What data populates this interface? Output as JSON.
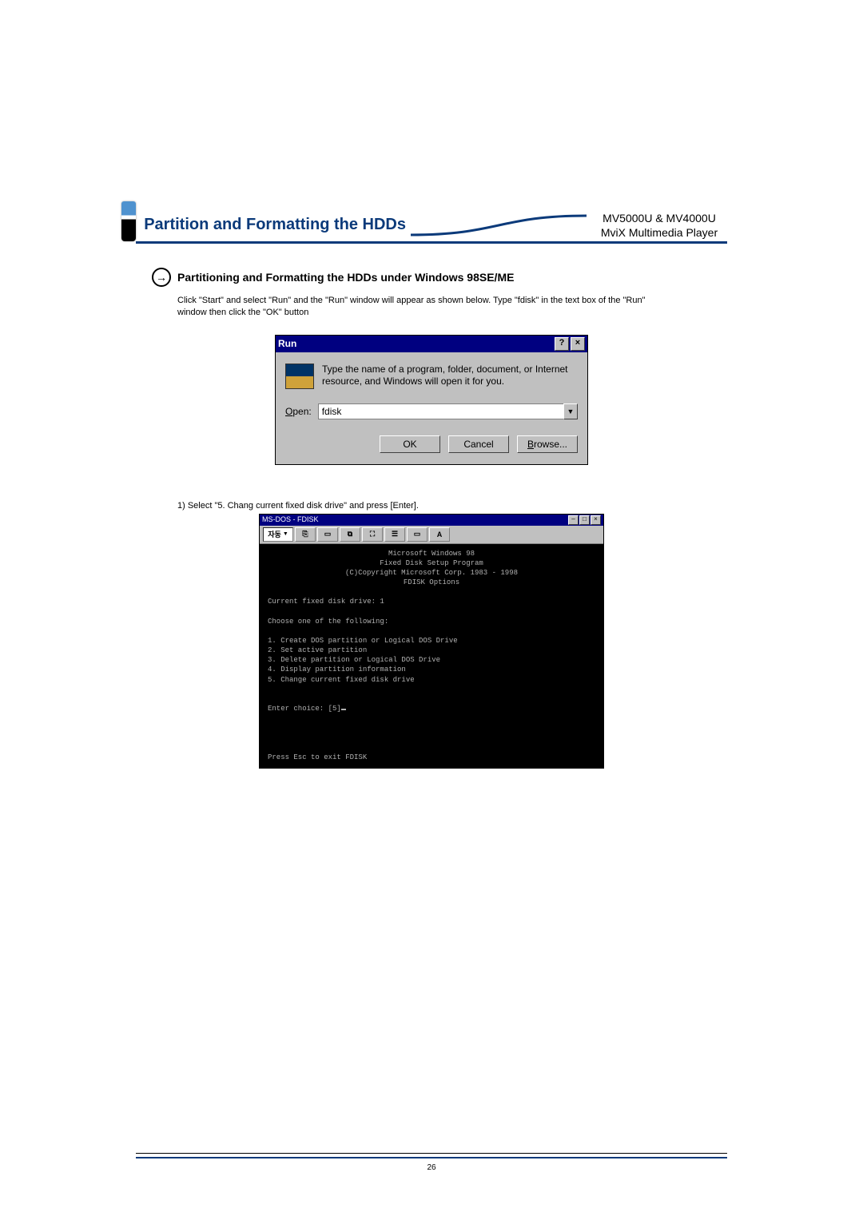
{
  "header": {
    "title": "Partition and Formatting the HDDs",
    "model_line1": "MV5000U & MV4000U",
    "model_line2": "MviX Multimedia Player"
  },
  "section": {
    "heading": "Partitioning and Formatting the HDDs under Windows 98SE/ME",
    "body": "Click \"Start\" and select \"Run\" and the \"Run\" window will appear as shown below. Type \"fdisk\" in the text box of the \"Run\" window then click the \"OK\" button"
  },
  "run_dialog": {
    "title": "Run",
    "help_btn": "?",
    "close_btn": "×",
    "message": "Type the name of a program, folder, document, or Internet resource, and Windows will open it for you.",
    "open_label_u": "O",
    "open_label_rest": "pen:",
    "open_value": "fdisk",
    "btn_ok": "OK",
    "btn_cancel": "Cancel",
    "btn_browse_u": "B",
    "btn_browse_rest": "rowse..."
  },
  "step1": "1) Select \"5. Chang current fixed disk drive\" and press [Enter].",
  "dos": {
    "title": "MS-DOS - FDISK",
    "toolbar_sel": "자동",
    "toolbar_font": "A",
    "min_btn": "–",
    "max_btn": "□",
    "close_btn": "×",
    "lines_center": [
      "Microsoft Windows 98",
      "Fixed Disk Setup Program",
      "(C)Copyright Microsoft Corp. 1983 - 1998",
      "",
      "FDISK Options"
    ],
    "line_current": "Current fixed disk drive: 1",
    "line_choose": "Choose one of the following:",
    "opts": [
      "1. Create DOS partition or Logical DOS Drive",
      "2. Set active partition",
      "3. Delete partition or Logical DOS Drive",
      "4. Display partition information",
      "5. Change current fixed disk drive"
    ],
    "enter_choice": "Enter choice: [5]",
    "exit": "Press Esc to exit FDISK"
  },
  "page_number": "26"
}
